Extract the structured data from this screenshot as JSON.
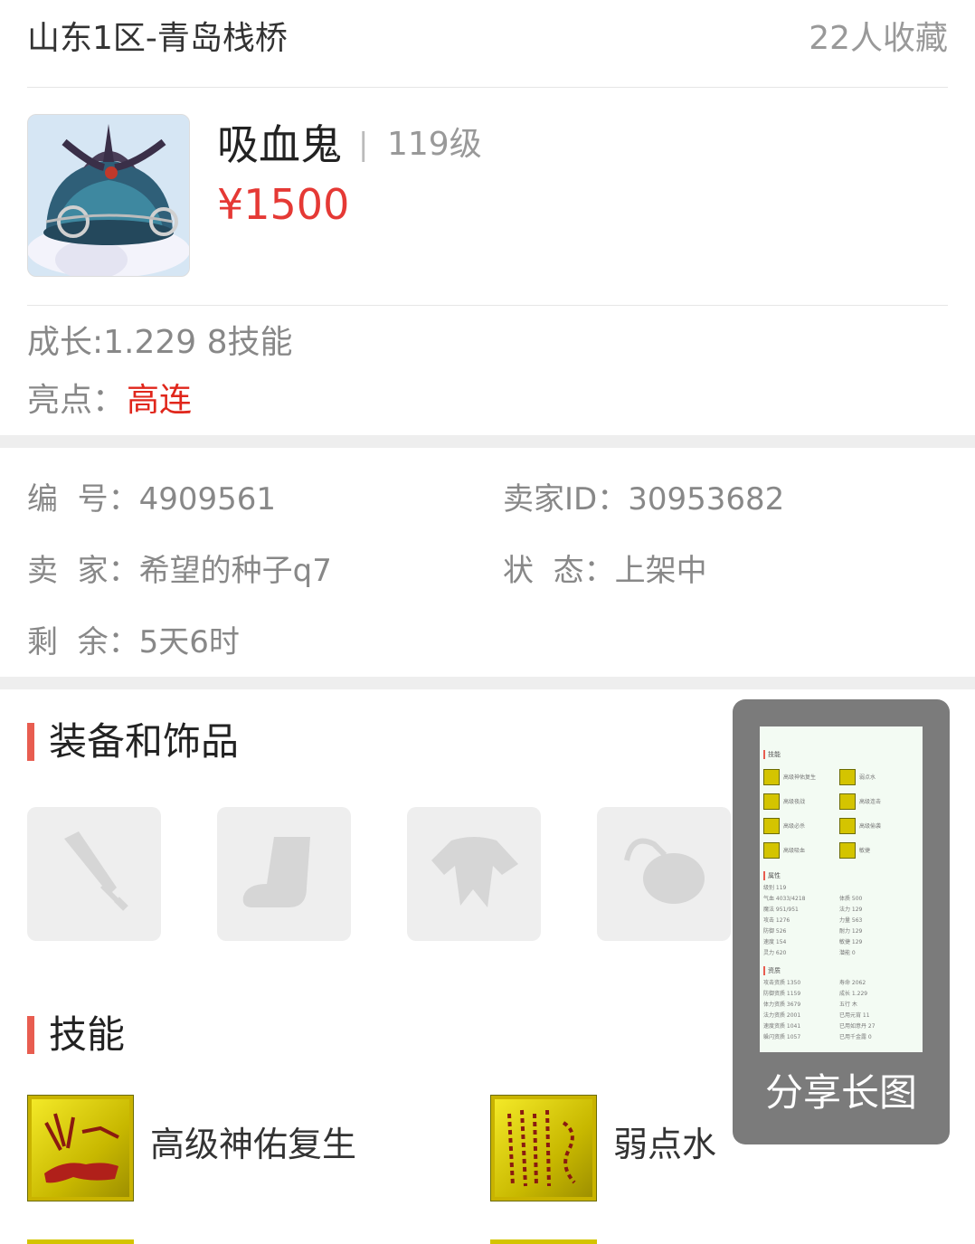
{
  "header": {
    "server": "山东1区-青岛栈桥",
    "favorites": "22人收藏"
  },
  "pet": {
    "name": "吸血鬼",
    "separator": "|",
    "level": "119级",
    "price": "¥1500"
  },
  "summary": {
    "growth_line": "成长:1.229 8技能",
    "highlight_label": "亮点：",
    "highlight_value": "高连"
  },
  "info": {
    "id_label": "编  号：",
    "id_value": "4909561",
    "seller_id_label": "卖家ID：",
    "seller_id_value": "30953682",
    "seller_label": "卖  家：",
    "seller_value": "希望的种子q7",
    "status_label": "状  态：",
    "status_value": "上架中",
    "remaining_label": "剩  余：",
    "remaining_value": "5天6时"
  },
  "equipment": {
    "title": "装备和饰品",
    "slots": [
      {
        "icon": "weapon-icon"
      },
      {
        "icon": "boot-icon"
      },
      {
        "icon": "armor-icon"
      },
      {
        "icon": "accessory-icon"
      }
    ]
  },
  "skills": {
    "title": "技能",
    "items": [
      {
        "name": "高级神佑复生",
        "icon": "revive-skill-icon"
      },
      {
        "name": "弱点水",
        "icon": "weak-water-skill-icon"
      }
    ]
  },
  "share": {
    "label": "分享长图",
    "thumb": {
      "skills_title": "技能",
      "skills": [
        "高级神佑复生",
        "弱点水",
        "高级夜战",
        "高级连击",
        "高级必杀",
        "高级偷袭",
        "高级吸血",
        "敏捷"
      ],
      "attr_title": "属性",
      "attrs": [
        "级别 119",
        "气血 4033/4218",
        "体质 500",
        "魔法 951/951",
        "法力 129",
        "攻击 1276",
        "力量 563",
        "防御 526",
        "耐力 129",
        "速度 154",
        "敏捷 129",
        "灵力 620",
        "潜能 0"
      ],
      "apt_title": "资质",
      "apts": [
        "攻击资质 1350",
        "寿命 2062",
        "防御资质 1159",
        "成长 1.229",
        "体力资质 3679",
        "五行 木",
        "法力资质 2001",
        "已用元宵 11",
        "速度资质 1041",
        "已用如意丹 27",
        "躲闪资质 1057",
        "已用千金露 0"
      ]
    }
  },
  "colors": {
    "accent_red": "#e53935",
    "section_bar": "#e85d50",
    "skill_gold": "#d4c400",
    "share_bg": "#7b7b7b"
  }
}
